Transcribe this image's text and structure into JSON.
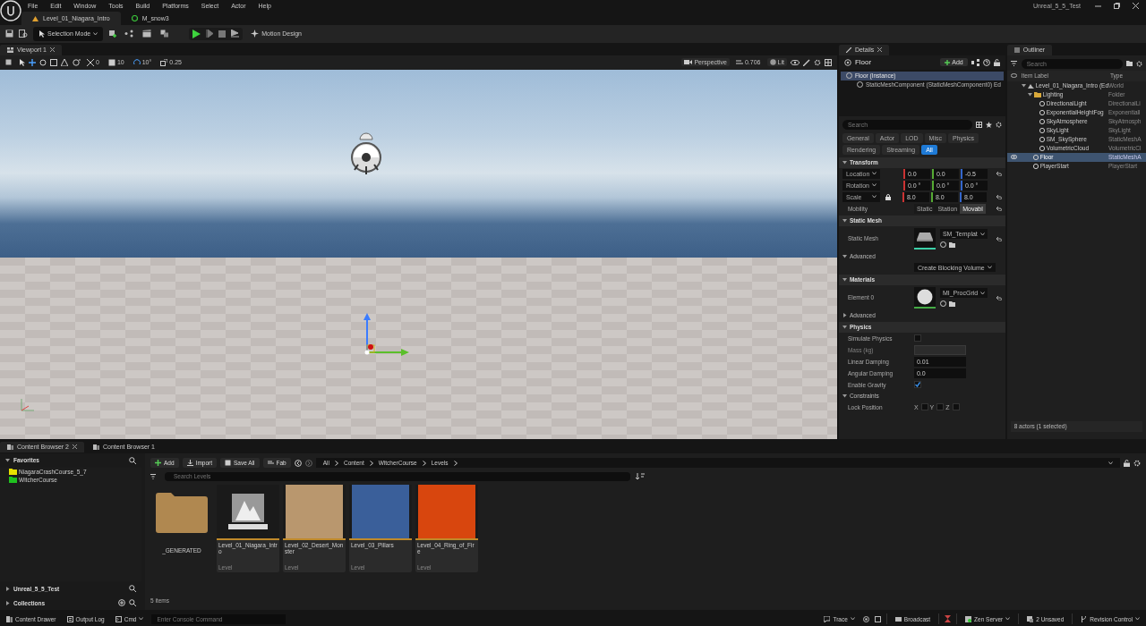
{
  "menu": [
    "File",
    "Edit",
    "Window",
    "Tools",
    "Build",
    "Platforms",
    "Select",
    "Actor",
    "Help"
  ],
  "window_title": "Unreal_5_5_Test",
  "document_tabs": [
    {
      "label": "Level_01_Niagara_Intro",
      "selected": true,
      "kind": "level"
    },
    {
      "label": "M_snow3",
      "selected": false,
      "kind": "material"
    }
  ],
  "toolbar": {
    "selection_mode": "Selection Mode",
    "motion_design": "Motion Design"
  },
  "viewport": {
    "tab": "Viewport 1",
    "snaps": [
      "0",
      "10",
      "10°",
      "0.25"
    ],
    "view_mode": "Perspective",
    "camera_speed": "0.706",
    "lighting": "Lit"
  },
  "details": {
    "tab": "Details",
    "actor": "Floor",
    "add": "Add",
    "components": [
      {
        "label": "Floor (Instance)",
        "selected": true
      },
      {
        "label": "StaticMeshComponent (StaticMeshComponent0) Ed",
        "selected": false
      }
    ],
    "search_placeholder": "Search",
    "filters": [
      {
        "label": "General",
        "selected": false
      },
      {
        "label": "Actor",
        "selected": false
      },
      {
        "label": "LOD",
        "selected": false
      },
      {
        "label": "Misc",
        "selected": false
      },
      {
        "label": "Physics",
        "selected": false
      },
      {
        "label": "Rendering",
        "selected": false
      },
      {
        "label": "Streaming",
        "selected": false
      },
      {
        "label": "All",
        "selected": true
      }
    ],
    "sections": [
      {
        "title": "Transform",
        "kind": "category",
        "expanded": true,
        "rows": [
          {
            "kind": "vector",
            "label": "Location",
            "values": [
              "0.0",
              "0.0",
              "-0.5"
            ],
            "lock": false,
            "reset": true
          },
          {
            "kind": "vector",
            "label": "Rotation",
            "values": [
              "0.0 °",
              "0.0 °",
              "0.0 °"
            ],
            "lock": false,
            "reset": false
          },
          {
            "kind": "vector",
            "label": "Scale",
            "values": [
              "8.0",
              "8.0",
              "8.0"
            ],
            "lock": true,
            "reset": true
          },
          {
            "kind": "mobility",
            "label": "Mobility",
            "options": [
              {
                "label": "Static",
                "selected": false
              },
              {
                "label": "Station",
                "selected": false
              },
              {
                "label": "Movabl",
                "selected": true
              }
            ],
            "reset": true
          }
        ]
      },
      {
        "title": "Static Mesh",
        "kind": "category",
        "expanded": true,
        "rows": [
          {
            "kind": "mesh_asset",
            "label": "Static Mesh",
            "value": "SM_Templat",
            "reset": true
          }
        ]
      },
      {
        "title": "Advanced",
        "kind": "subcategory",
        "expanded": true,
        "rows": [
          {
            "kind": "button",
            "label": "Create Blocking Volume"
          }
        ]
      },
      {
        "title": "Materials",
        "kind": "category",
        "expanded": true,
        "rows": [
          {
            "kind": "material_asset",
            "label": "Element 0",
            "value": "MI_ProcGrid",
            "reset": true
          }
        ]
      },
      {
        "title": "Advanced",
        "kind": "subcategory",
        "expanded": false
      },
      {
        "title": "Physics",
        "kind": "category",
        "expanded": true,
        "rows": [
          {
            "kind": "checkbox",
            "label": "Simulate Physics",
            "checked": false
          },
          {
            "kind": "disabled",
            "label": "Mass (kg)"
          },
          {
            "kind": "number",
            "label": "Linear Damping",
            "value": "0.01"
          },
          {
            "kind": "number",
            "label": "Angular Damping",
            "value": "0.0"
          },
          {
            "kind": "checkbox",
            "label": "Enable Gravity",
            "checked": true
          }
        ]
      },
      {
        "title": "Constraints",
        "kind": "subcategory",
        "expanded": true,
        "rows": [
          {
            "kind": "axes",
            "label": "Lock Position",
            "axes": [
              {
                "label": "X",
                "checked": false
              },
              {
                "label": "Y",
                "checked": false
              },
              {
                "label": "Z",
                "checked": false
              }
            ]
          }
        ]
      }
    ]
  },
  "outliner": {
    "tab": "Outliner",
    "search_placeholder": "Search",
    "columns": [
      "Item Label",
      "Type"
    ],
    "tree": [
      {
        "label": "Level_01_Niagara_Intro (Ed",
        "type": "World",
        "kind": "world",
        "selected": false,
        "expanded": true,
        "children": [
          {
            "label": "Lighting",
            "type": "Folder",
            "kind": "folder",
            "selected": false,
            "expanded": true,
            "children": [
              {
                "label": "DirectionalLight",
                "type": "DirectionalLi",
                "kind": "actor",
                "selected": false
              },
              {
                "label": "ExponentialHeightFog",
                "type": "Exponentiall",
                "kind": "actor",
                "selected": false
              },
              {
                "label": "SkyAtmosphere",
                "type": "SkyAtmosph",
                "kind": "actor",
                "selected": false
              },
              {
                "label": "SkyLight",
                "type": "SkyLight",
                "kind": "actor",
                "selected": false
              },
              {
                "label": "SM_SkySphere",
                "type": "StaticMeshA",
                "kind": "actor",
                "selected": false
              },
              {
                "label": "VolumetricCloud",
                "type": "VolumetricCl",
                "kind": "actor",
                "selected": false
              }
            ]
          },
          {
            "label": "Floor",
            "type": "StaticMeshA",
            "kind": "actor",
            "selected": true
          },
          {
            "label": "PlayerStart",
            "type": "PlayerStart",
            "kind": "actor",
            "selected": false
          }
        ]
      }
    ],
    "footer": "8 actors (1 selected)"
  },
  "content_browser": {
    "tabs": [
      {
        "label": "Content Browser 2",
        "selected": true
      },
      {
        "label": "Content Browser 1",
        "selected": false
      }
    ],
    "favorites_title": "Favorites",
    "favorites": [
      {
        "label": "NiagaraCrashCourse_5_7",
        "color": "#e8e000"
      },
      {
        "label": "WitcherCourse",
        "color": "#1fc21f"
      }
    ],
    "sections": [
      "Unreal_5_5_Test",
      "Collections"
    ],
    "actions": [
      "Add",
      "Import",
      "Save All",
      "Fab"
    ],
    "path": [
      "All",
      "Content",
      "WitcherCourse",
      "Levels"
    ],
    "search_placeholder": "Search Levels",
    "assets": [
      {
        "name": "_GENERATED",
        "kind": "folder"
      },
      {
        "name": "Level_01_Niagara_Intro",
        "kind": "level",
        "type": "Level"
      },
      {
        "name": "Level_02_Desert_Monster",
        "kind": "photo",
        "color": "#b9976e",
        "type": "Level"
      },
      {
        "name": "Level_03_Pillars",
        "kind": "photo",
        "color": "#3a5f9a",
        "type": "Level"
      },
      {
        "name": "Level_04_Ring_of_Fire",
        "kind": "photo",
        "color": "#d8460e",
        "type": "Level"
      }
    ],
    "count": "5 items"
  },
  "status_bar": {
    "left": [
      "Content Drawer",
      "Output Log",
      "Cmd"
    ],
    "console_placeholder": "Enter Console Command",
    "right": [
      "Trace",
      "Broadcast",
      "Zen Server",
      "2 Unsaved",
      "Revision Control"
    ]
  }
}
